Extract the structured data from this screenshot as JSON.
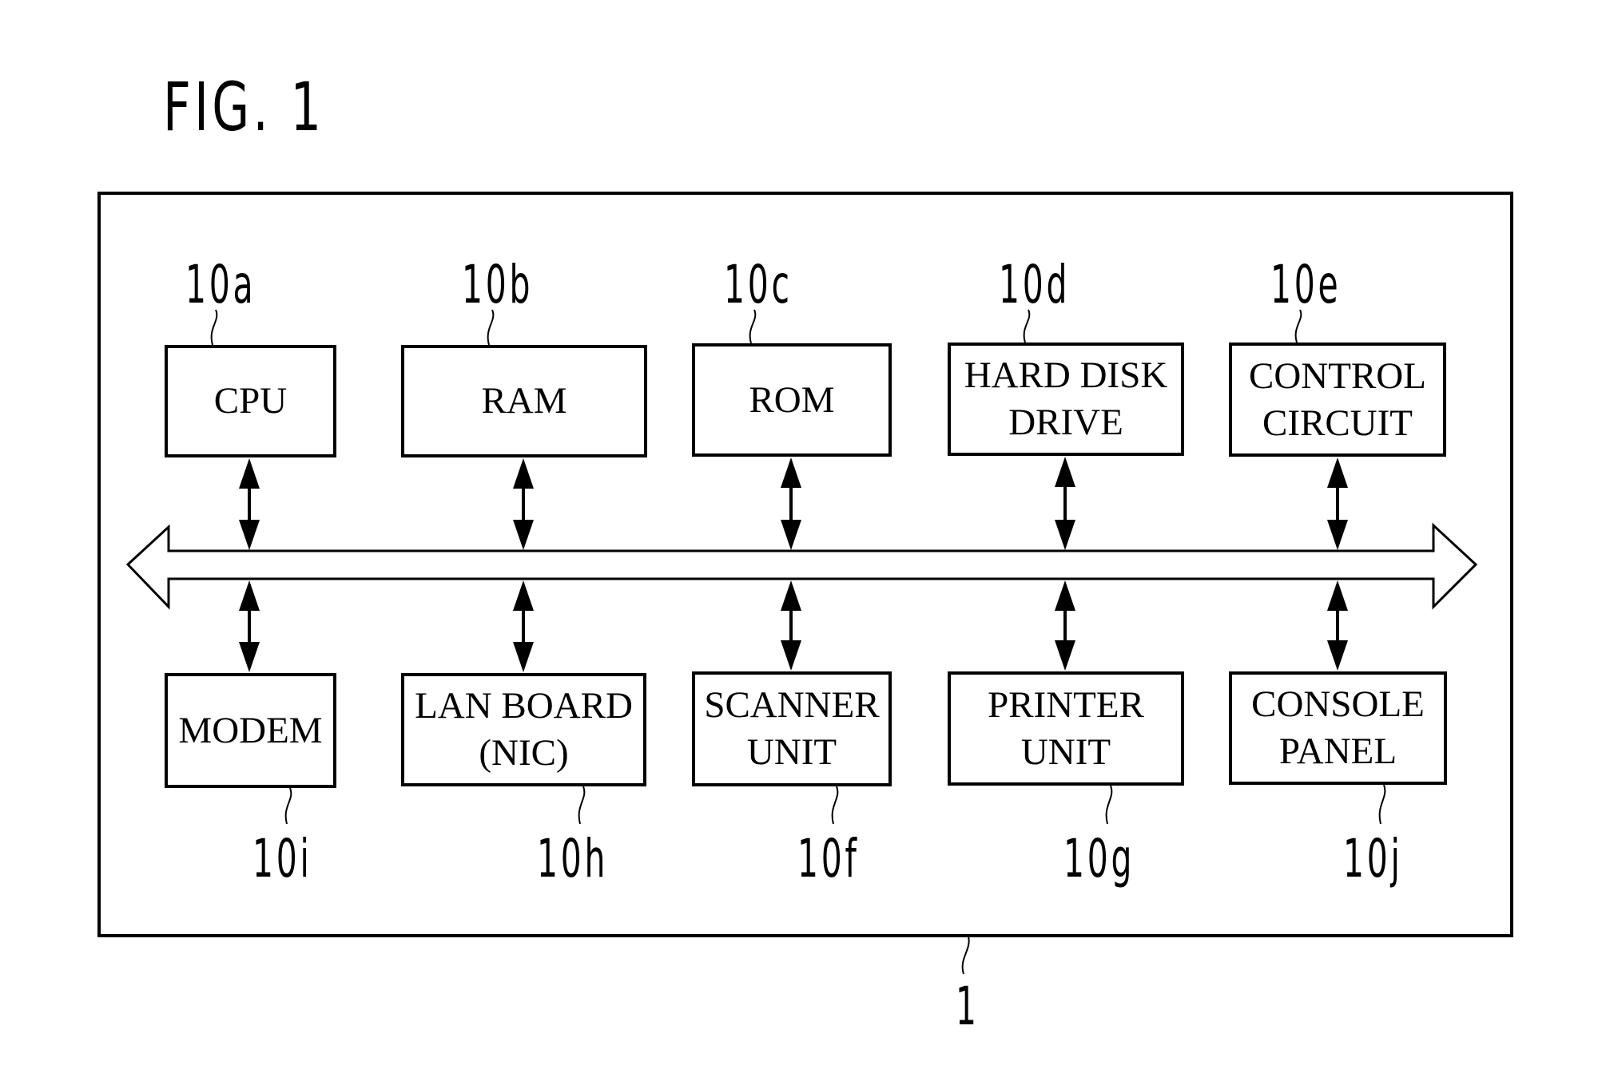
{
  "figure": {
    "title": "FIG. 1",
    "system_ref": "1"
  },
  "top_row": [
    {
      "ref": "10a",
      "lines": [
        "CPU"
      ]
    },
    {
      "ref": "10b",
      "lines": [
        "RAM"
      ]
    },
    {
      "ref": "10c",
      "lines": [
        "ROM"
      ]
    },
    {
      "ref": "10d",
      "lines": [
        "HARD DISK",
        "DRIVE"
      ]
    },
    {
      "ref": "10e",
      "lines": [
        "CONTROL",
        "CIRCUIT"
      ]
    }
  ],
  "bottom_row": [
    {
      "ref": "10i",
      "lines": [
        "MODEM"
      ]
    },
    {
      "ref": "10h",
      "lines": [
        "LAN BOARD",
        "(NIC)"
      ]
    },
    {
      "ref": "10f",
      "lines": [
        "SCANNER",
        "UNIT"
      ]
    },
    {
      "ref": "10g",
      "lines": [
        "PRINTER",
        "UNIT"
      ]
    },
    {
      "ref": "10j",
      "lines": [
        "CONSOLE",
        "PANEL"
      ]
    }
  ],
  "bus": {
    "direction": "bidirectional",
    "connections": "each block bidirectionally connected to bus"
  },
  "colors": {
    "line": "#000000",
    "background": "#ffffff"
  }
}
